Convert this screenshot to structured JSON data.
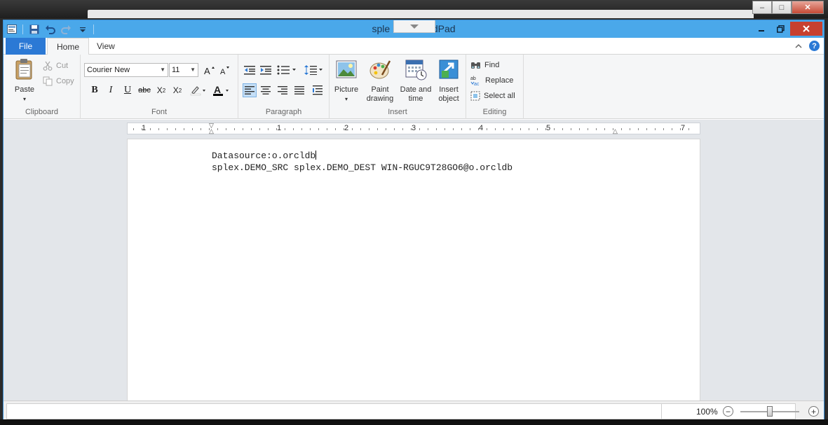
{
  "window": {
    "title": "splex - WordPad",
    "title_visible": "sple        rdPad"
  },
  "qat": {
    "icons": [
      "app-menu-icon",
      "save-icon",
      "undo-icon",
      "redo-icon",
      "customize-icon"
    ]
  },
  "tabs": {
    "file": "File",
    "home": "Home",
    "view": "View"
  },
  "clipboard": {
    "paste": "Paste",
    "cut": "Cut",
    "copy": "Copy",
    "label": "Clipboard"
  },
  "font": {
    "family": "Courier New",
    "size": "11",
    "label": "Font"
  },
  "paragraph": {
    "label": "Paragraph"
  },
  "insert": {
    "picture": "Picture",
    "paint_drawing_1": "Paint",
    "paint_drawing_2": "drawing",
    "date_time_1": "Date and",
    "date_time_2": "time",
    "insert_object_1": "Insert",
    "insert_object_2": "object",
    "label": "Insert"
  },
  "editing": {
    "find": "Find",
    "replace": "Replace",
    "select_all": "Select all",
    "label": "Editing"
  },
  "ruler": {
    "numbers": [
      "1",
      "1",
      "2",
      "3",
      "4",
      "5",
      "7"
    ]
  },
  "document": {
    "line1": "Datasource:o.orcldb",
    "line2": "splex.DEMO_SRC splex.DEMO_DEST WIN-RGUC9T28GO6@o.orcldb"
  },
  "status": {
    "zoom": "100%",
    "zoom_out": "−",
    "zoom_in": "+"
  },
  "colors": {
    "titlebar": "#4aa8ea",
    "file_tab": "#2b79d5",
    "close": "#c7402f"
  }
}
